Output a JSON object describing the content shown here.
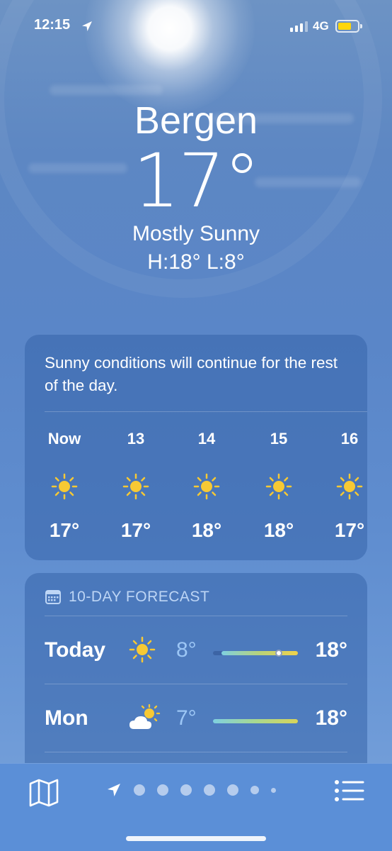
{
  "status_bar": {
    "time": "12:15",
    "network": "4G",
    "battery_color": "#ffd60a"
  },
  "location": {
    "city": "Bergen",
    "temperature": "17°",
    "condition": "Mostly Sunny",
    "high_low": "H:18°  L:8°"
  },
  "hourly": {
    "summary": "Sunny conditions will continue for the rest of the day.",
    "hours": [
      {
        "label": "Now",
        "icon": "sun-icon",
        "temp": "17°"
      },
      {
        "label": "13",
        "icon": "sun-icon",
        "temp": "17°"
      },
      {
        "label": "14",
        "icon": "sun-icon",
        "temp": "18°"
      },
      {
        "label": "15",
        "icon": "sun-icon",
        "temp": "18°"
      },
      {
        "label": "16",
        "icon": "sun-icon",
        "temp": "17°"
      }
    ]
  },
  "forecast": {
    "header": "10-DAY FORECAST",
    "days": [
      {
        "day": "Today",
        "icon": "sun-icon",
        "low": "8°",
        "high": "18°"
      },
      {
        "day": "Mon",
        "icon": "partly-cloudy-icon",
        "low": "7°",
        "high": "18°"
      }
    ]
  },
  "colors": {
    "sun": "#f7c934",
    "accent_low": "#9cc6f5"
  }
}
